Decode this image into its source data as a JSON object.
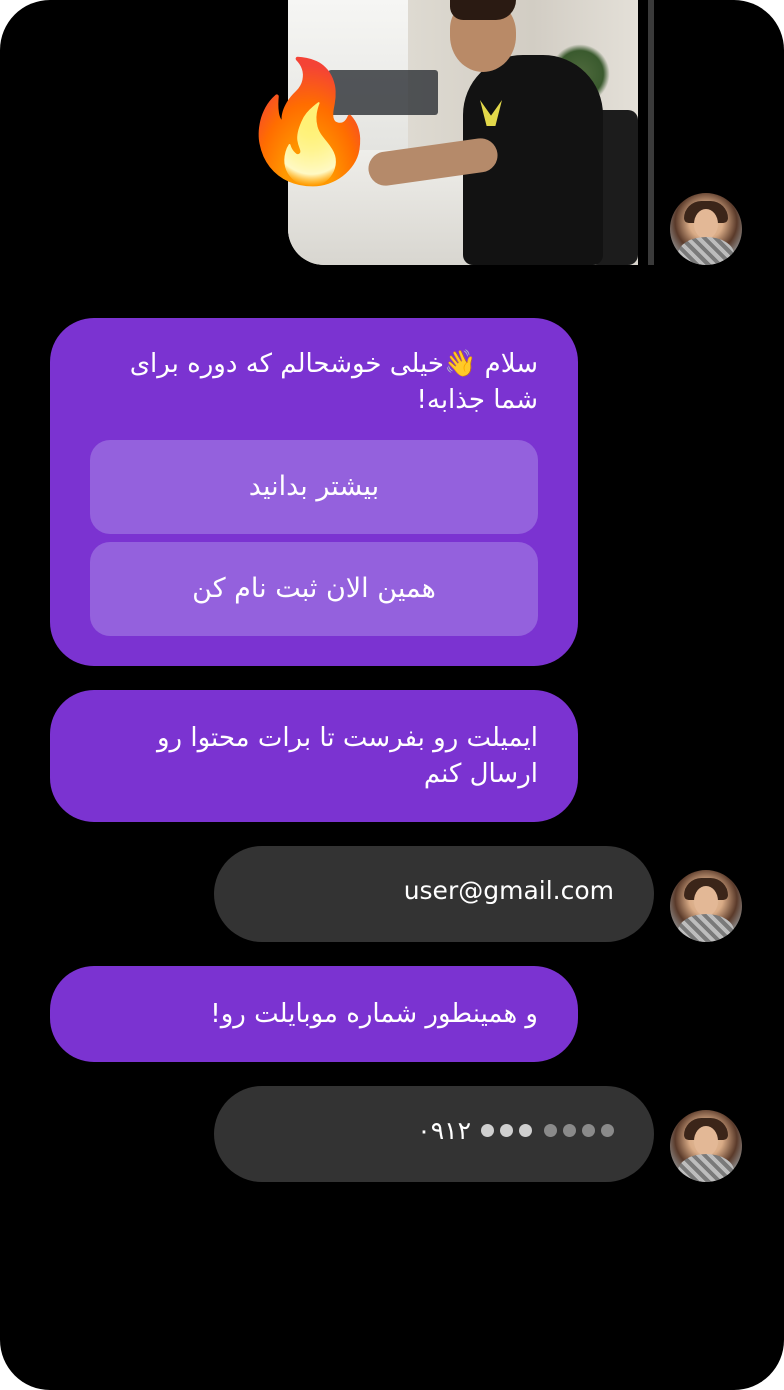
{
  "shared_media": {
    "emoji": "🔥"
  },
  "messages": {
    "greeting": "سلام 👋خیلی خوشحالم که دوره برای شما جذابه!",
    "buttons": [
      "بیشتر بدانید",
      "همین الان ثبت نام کن"
    ],
    "ask_email": "ایمیلت رو بفرست تا برات محتوا رو ارسال کنم",
    "email_value": "user@gmail.com",
    "ask_phone": "و همینطور شماره موبایلت رو!",
    "phone_prefix": "۰۹۱۲"
  },
  "colors": {
    "accent_purple": "#7b33d1",
    "button_purple": "#9461dd",
    "user_bubble": "#333333",
    "background": "#000000"
  }
}
